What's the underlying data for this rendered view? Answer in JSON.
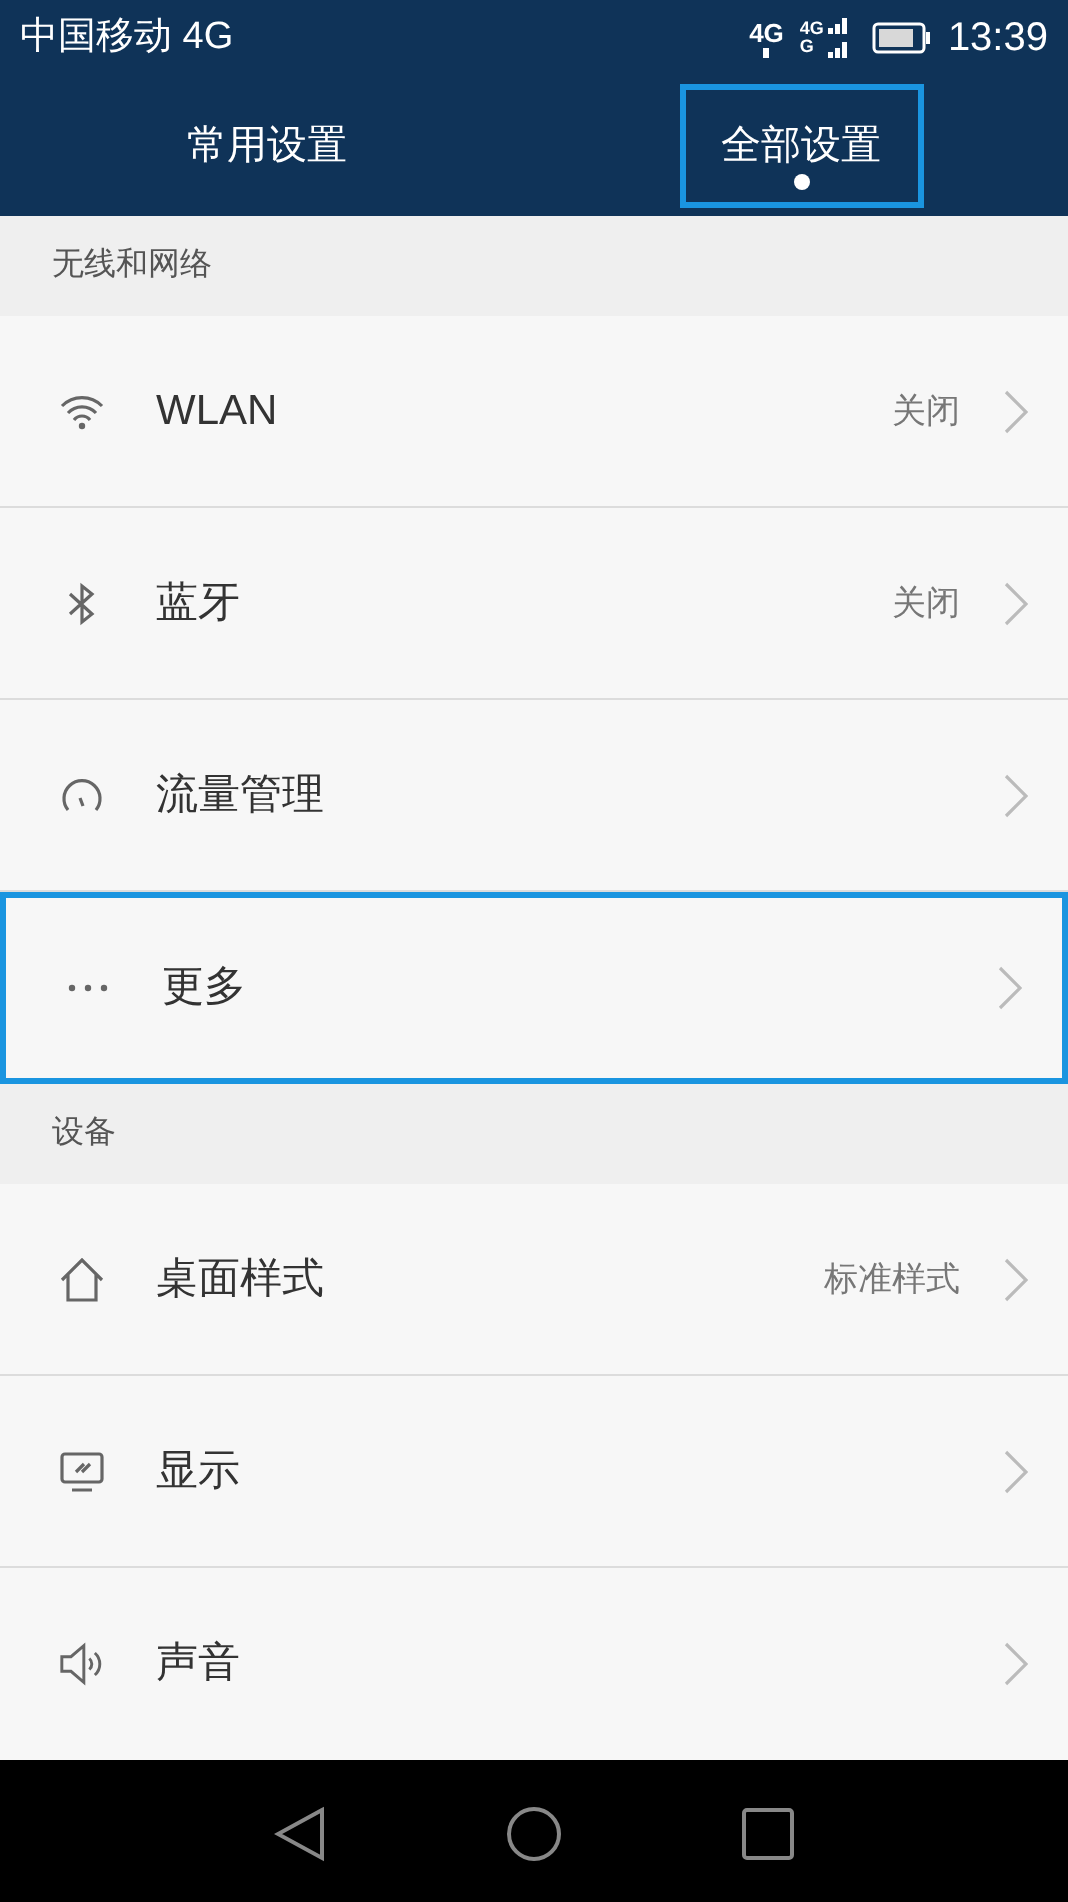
{
  "status_bar": {
    "carrier": "中国移动 4G",
    "network_type": "4G",
    "signal_labels": [
      "4G",
      "G"
    ],
    "time": "13:39"
  },
  "tabs": [
    {
      "label": "常用设置",
      "selected": false,
      "highlighted": false
    },
    {
      "label": "全部设置",
      "selected": true,
      "highlighted": true
    }
  ],
  "sections": [
    {
      "title": "无线和网络",
      "items": [
        {
          "label": "WLAN",
          "value": "关闭",
          "highlighted": false
        },
        {
          "label": "蓝牙",
          "value": "关闭",
          "highlighted": false
        },
        {
          "label": "流量管理",
          "highlighted": false
        },
        {
          "label": "更多",
          "highlighted": true
        }
      ]
    },
    {
      "title": "设备",
      "items": [
        {
          "label": "桌面样式",
          "value": "标准样式",
          "highlighted": false
        },
        {
          "label": "显示",
          "highlighted": false
        },
        {
          "label": "声音",
          "highlighted": false
        }
      ]
    }
  ]
}
